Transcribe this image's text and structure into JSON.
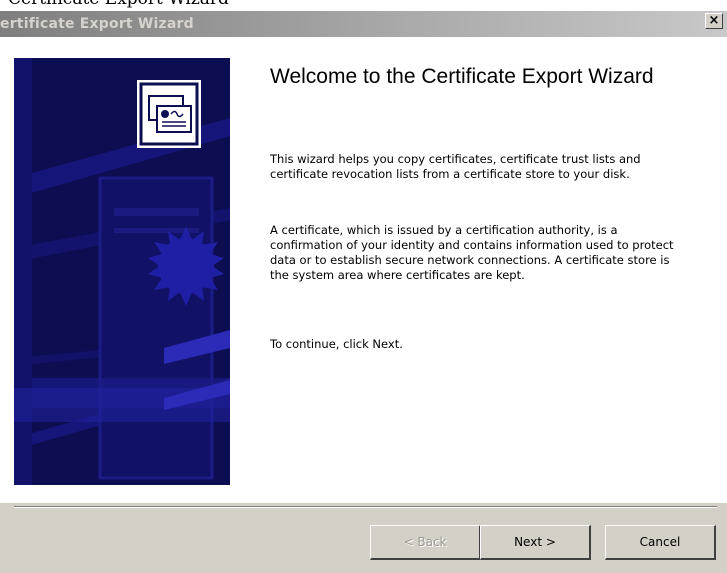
{
  "window": {
    "title": "ertificate Export Wizard",
    "close_glyph": "✕"
  },
  "cropped_caption": "Certificate Export Wizard",
  "banner": {
    "icon": "certificate-icon",
    "background_color": "#0d0d52"
  },
  "main": {
    "title": "Welcome to the Certificate Export Wizard",
    "paragraph1": "This wizard helps you copy certificates, certificate trust lists and certificate revocation lists from a certificate store to your disk.",
    "paragraph2": "A certificate, which is issued by a certification authority, is a confirmation of your identity and contains information used to protect data or to establish secure network connections. A certificate store is the system area where certificates are kept.",
    "paragraph3": "To continue, click Next."
  },
  "buttons": {
    "back": "< Back",
    "next": "Next >",
    "cancel": "Cancel"
  }
}
